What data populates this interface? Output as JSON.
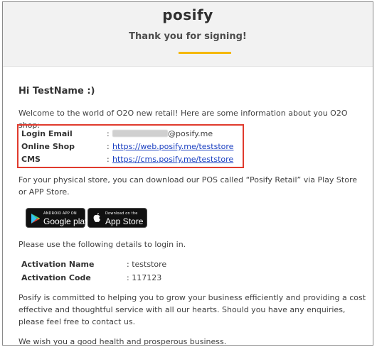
{
  "header": {
    "logo_text": "posify",
    "title": "Thank you for signing!",
    "accent_color": "#f5b800"
  },
  "body": {
    "greeting": "Hi TestName :)",
    "intro": "Welcome to the world of O2O new retail! Here are some information about you O2O shop:",
    "info_box_color": "#e03a2d",
    "info": [
      {
        "label": "Login Email",
        "value": "@posify.me",
        "value_prefix_redacted": true
      },
      {
        "label": "Online Shop",
        "value": "https://web.posify.me/teststore"
      },
      {
        "label": "CMS",
        "value": "https://cms.posify.me/teststore"
      }
    ],
    "separator": ":",
    "download_text": "For your physical store, you can download our POS called “Posify Retail” via Play Store or APP Store.",
    "badges": {
      "google": {
        "small": "ANDROID APP ON",
        "big": "Google play",
        "icon": "google-play-icon"
      },
      "apple": {
        "small": "Download on the",
        "big": "App Store",
        "icon": "apple-icon"
      }
    },
    "login_text": "Please use the following details to login in.",
    "activation": [
      {
        "label": "Activation Name",
        "value": ": teststore"
      },
      {
        "label": "Activation Code",
        "value": ": 117123"
      }
    ],
    "commitment_text": "Posify is committed to helping you to grow your business efficiently and providing a cost effective and thoughtful service with all our hearts. Should you have any enquiries, please feel free to contact us.",
    "closing_text": "We wish you a good health and prosperous business."
  }
}
